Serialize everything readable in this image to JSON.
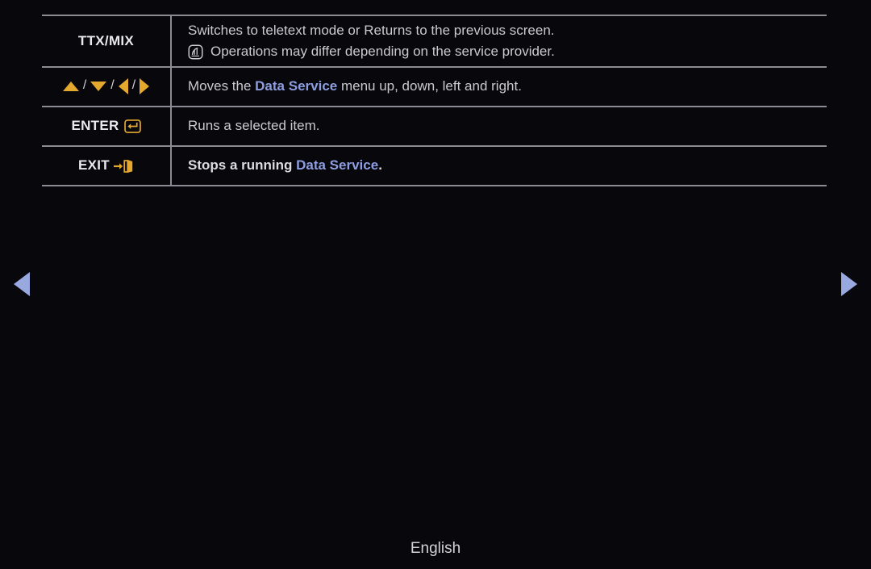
{
  "screen": {
    "background_color": "#07070c",
    "text_color": "#c9c9d0",
    "accent_gold": "#e5a82e",
    "accent_blue": "#8e9ee0",
    "border_color": "#8b8b93",
    "nav_arrow_color": "#9aa8e0"
  },
  "table": {
    "rows": [
      {
        "key_label": "TTX/MIX",
        "key_icon": "",
        "desc_lines": [
          {
            "type": "plain",
            "text": "Switches to teletext mode or Returns to the previous screen."
          },
          {
            "type": "note",
            "icon": "note-icon",
            "text": "Operations may differ depending on the service provider."
          }
        ]
      },
      {
        "key_label": "",
        "key_icon": "arrow-keys",
        "desc_prefix": "Moves the ",
        "desc_highlight": "Data Service",
        "desc_suffix": " menu up, down, left and right."
      },
      {
        "key_label": "ENTER",
        "key_icon": "enter-icon",
        "desc_plain": "Runs a selected item."
      },
      {
        "key_label": "EXIT",
        "key_icon": "exit-icon",
        "desc_prefix": "Stops a running ",
        "desc_highlight": "Data Service",
        "desc_suffix": "."
      }
    ],
    "arrow_keys": {
      "up": "triangle-up-icon",
      "down": "triangle-down-icon",
      "left": "triangle-left-icon",
      "right": "triangle-right-icon",
      "separator": "/"
    }
  },
  "navigation": {
    "prev_label": "previous-page-arrow",
    "next_label": "next-page-arrow"
  },
  "footer": {
    "language": "English"
  }
}
